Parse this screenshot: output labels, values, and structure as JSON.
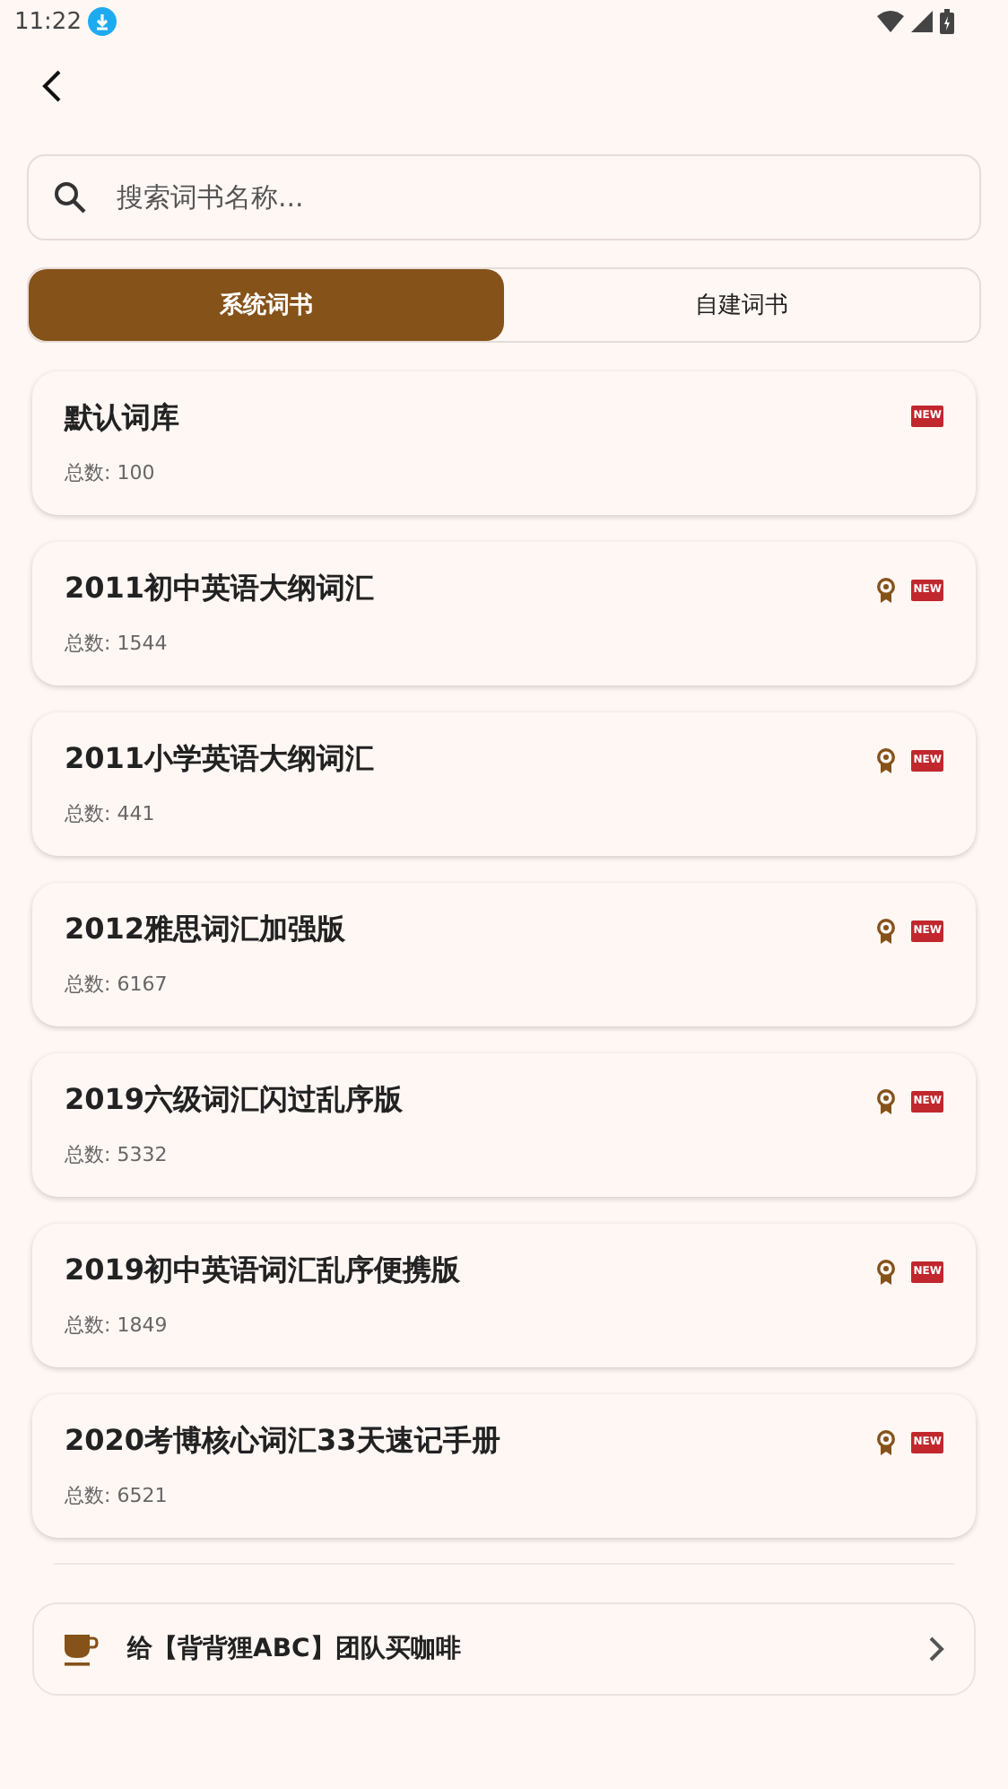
{
  "status_bar": {
    "time": "11:22"
  },
  "search": {
    "placeholder": "搜索词书名称..."
  },
  "tabs": [
    {
      "label": "系统词书",
      "selected": true
    },
    {
      "label": "自建词书",
      "selected": false
    }
  ],
  "books": [
    {
      "title": "默认词库",
      "count": "总数: 100",
      "award": false,
      "badge": "NEW"
    },
    {
      "title": "2011初中英语大纲词汇",
      "count": "总数: 1544",
      "award": true,
      "badge": "NEW"
    },
    {
      "title": "2011小学英语大纲词汇",
      "count": "总数: 441",
      "award": true,
      "badge": "NEW"
    },
    {
      "title": "2012雅思词汇加强版",
      "count": "总数: 6167",
      "award": true,
      "badge": "NEW"
    },
    {
      "title": "2019六级词汇闪过乱序版",
      "count": "总数: 5332",
      "award": true,
      "badge": "NEW"
    },
    {
      "title": "2019初中英语词汇乱序便携版",
      "count": "总数: 1849",
      "award": true,
      "badge": "NEW"
    },
    {
      "title": "2020考博核心词汇33天速记手册",
      "count": "总数: 6521",
      "award": true,
      "badge": "NEW"
    }
  ],
  "coffee": {
    "label": "给【背背狸ABC】团队买咖啡"
  }
}
